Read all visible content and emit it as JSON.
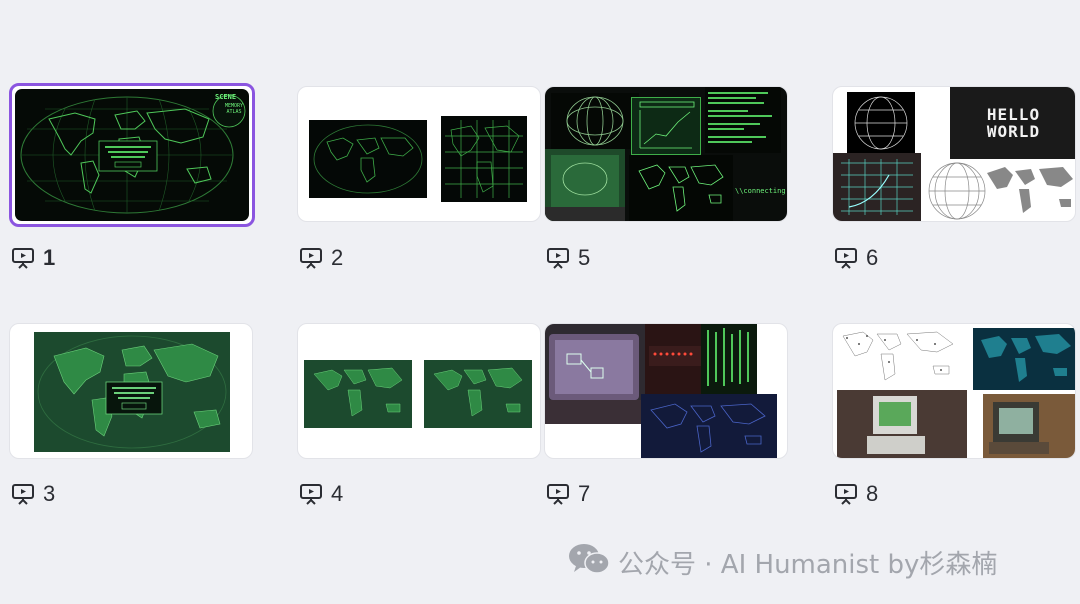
{
  "slides": [
    {
      "number": "1",
      "selected": true
    },
    {
      "number": "2",
      "selected": false
    },
    {
      "number": "5",
      "selected": false
    },
    {
      "number": "6",
      "selected": false
    },
    {
      "number": "3",
      "selected": false
    },
    {
      "number": "4",
      "selected": false
    },
    {
      "number": "7",
      "selected": false
    },
    {
      "number": "8",
      "selected": false
    }
  ],
  "thumb_texts": {
    "scene_badge_top": "SCENE",
    "scene_badge_bottom": "MEMORY ATLAS",
    "hello_world_line1": "HELLO",
    "hello_world_line2": "WORLD",
    "connecting": "\\\\connecting..."
  },
  "watermark": {
    "icon": "wechat-icon",
    "text": "公众号 · AI Humanist by杉森楠"
  },
  "colors": {
    "selection_border": "#8b55e0",
    "background": "#eff0f4",
    "terminal_green": "#6df27a"
  }
}
